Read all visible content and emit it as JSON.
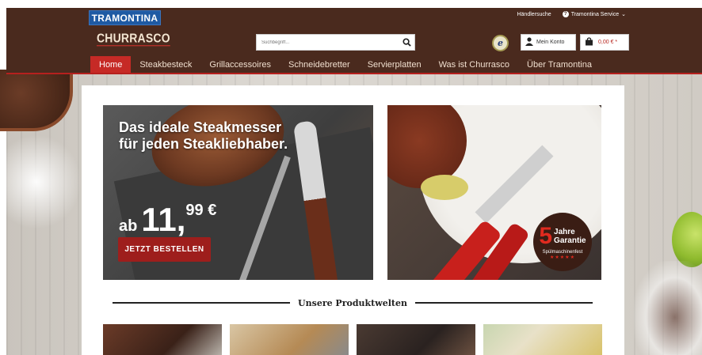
{
  "brand": {
    "logo_text": "TRAMONTINA",
    "sub_logo": "CHURRASCO"
  },
  "toplinks": {
    "dealer": "Händlersuche",
    "service": "Tramontina Service"
  },
  "search": {
    "placeholder": "Suchbegriff..."
  },
  "account": {
    "label": "Mein Konto"
  },
  "cart": {
    "amount": "0,00 € *"
  },
  "nav": {
    "items": [
      "Home",
      "Steakbesteck",
      "Grillaccessoires",
      "Schneidebretter",
      "Servierplatten",
      "Was ist Churrasco",
      "Über Tramontina"
    ],
    "active_index": 0
  },
  "banner_left": {
    "title": "Das ideale Steakmesser für jeden Steakliebhaber.",
    "price_prefix": "ab",
    "price_main": "11,",
    "price_cents": "99 €",
    "cta": "JETZT BESTELLEN"
  },
  "banner_right": {
    "guarantee_number": "5",
    "guarantee_line1": "Jahre",
    "guarantee_line2": "Garantie",
    "guarantee_sub": "Spülmaschinenfest",
    "guarantee_stars": "★★★★★"
  },
  "section": {
    "heading": "Unsere Produktwelten"
  },
  "colors": {
    "header_bg": "#4a2a1e",
    "accent_red": "#c62a26",
    "logo_blue": "#1f5aa3"
  }
}
